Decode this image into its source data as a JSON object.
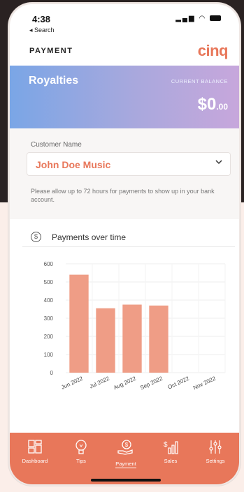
{
  "status_bar": {
    "time": "4:38",
    "back_label": "◂ Search",
    "icons": [
      "signal-icon",
      "wifi-icon",
      "battery-icon"
    ]
  },
  "app_bar": {
    "title": "PAYMENT",
    "logo": "cinq"
  },
  "balance": {
    "label": "Royalties",
    "current_balance_label": "CURRENT BALANCE",
    "amount": "$0",
    "cents": ".00"
  },
  "customer": {
    "label": "Customer Name",
    "selected": "John Doe Music",
    "notice": "Please allow up to 72 hours for payments to show up in your bank account."
  },
  "chart_card": {
    "title": "Payments over time",
    "icon": "dollar-circle-icon"
  },
  "chart_data": {
    "type": "bar",
    "categories": [
      "Jun 2022",
      "Jul 2022",
      "Aug 2022",
      "Sep 2022",
      "Oct 2022",
      "Nov 2022"
    ],
    "values": [
      540,
      355,
      375,
      370,
      0,
      0
    ],
    "ylim": [
      0,
      600
    ],
    "yticks": [
      "0",
      "100",
      "200",
      "300",
      "400",
      "500",
      "600"
    ],
    "bar_color": "#ef9d86",
    "grid": true,
    "title": "",
    "xlabel": "",
    "ylabel": ""
  },
  "tabs": [
    {
      "label": "Dashboard",
      "icon": "dashboard-icon",
      "active": false
    },
    {
      "label": "Tips",
      "icon": "lightbulb-icon",
      "active": false
    },
    {
      "label": "Payment",
      "icon": "payment-hand-icon",
      "active": true
    },
    {
      "label": "Sales",
      "icon": "sales-chart-icon",
      "active": false
    },
    {
      "label": "Settings",
      "icon": "sliders-icon",
      "active": false
    }
  ],
  "colors": {
    "accent": "#e8775a",
    "bar": "#ef9d86"
  }
}
